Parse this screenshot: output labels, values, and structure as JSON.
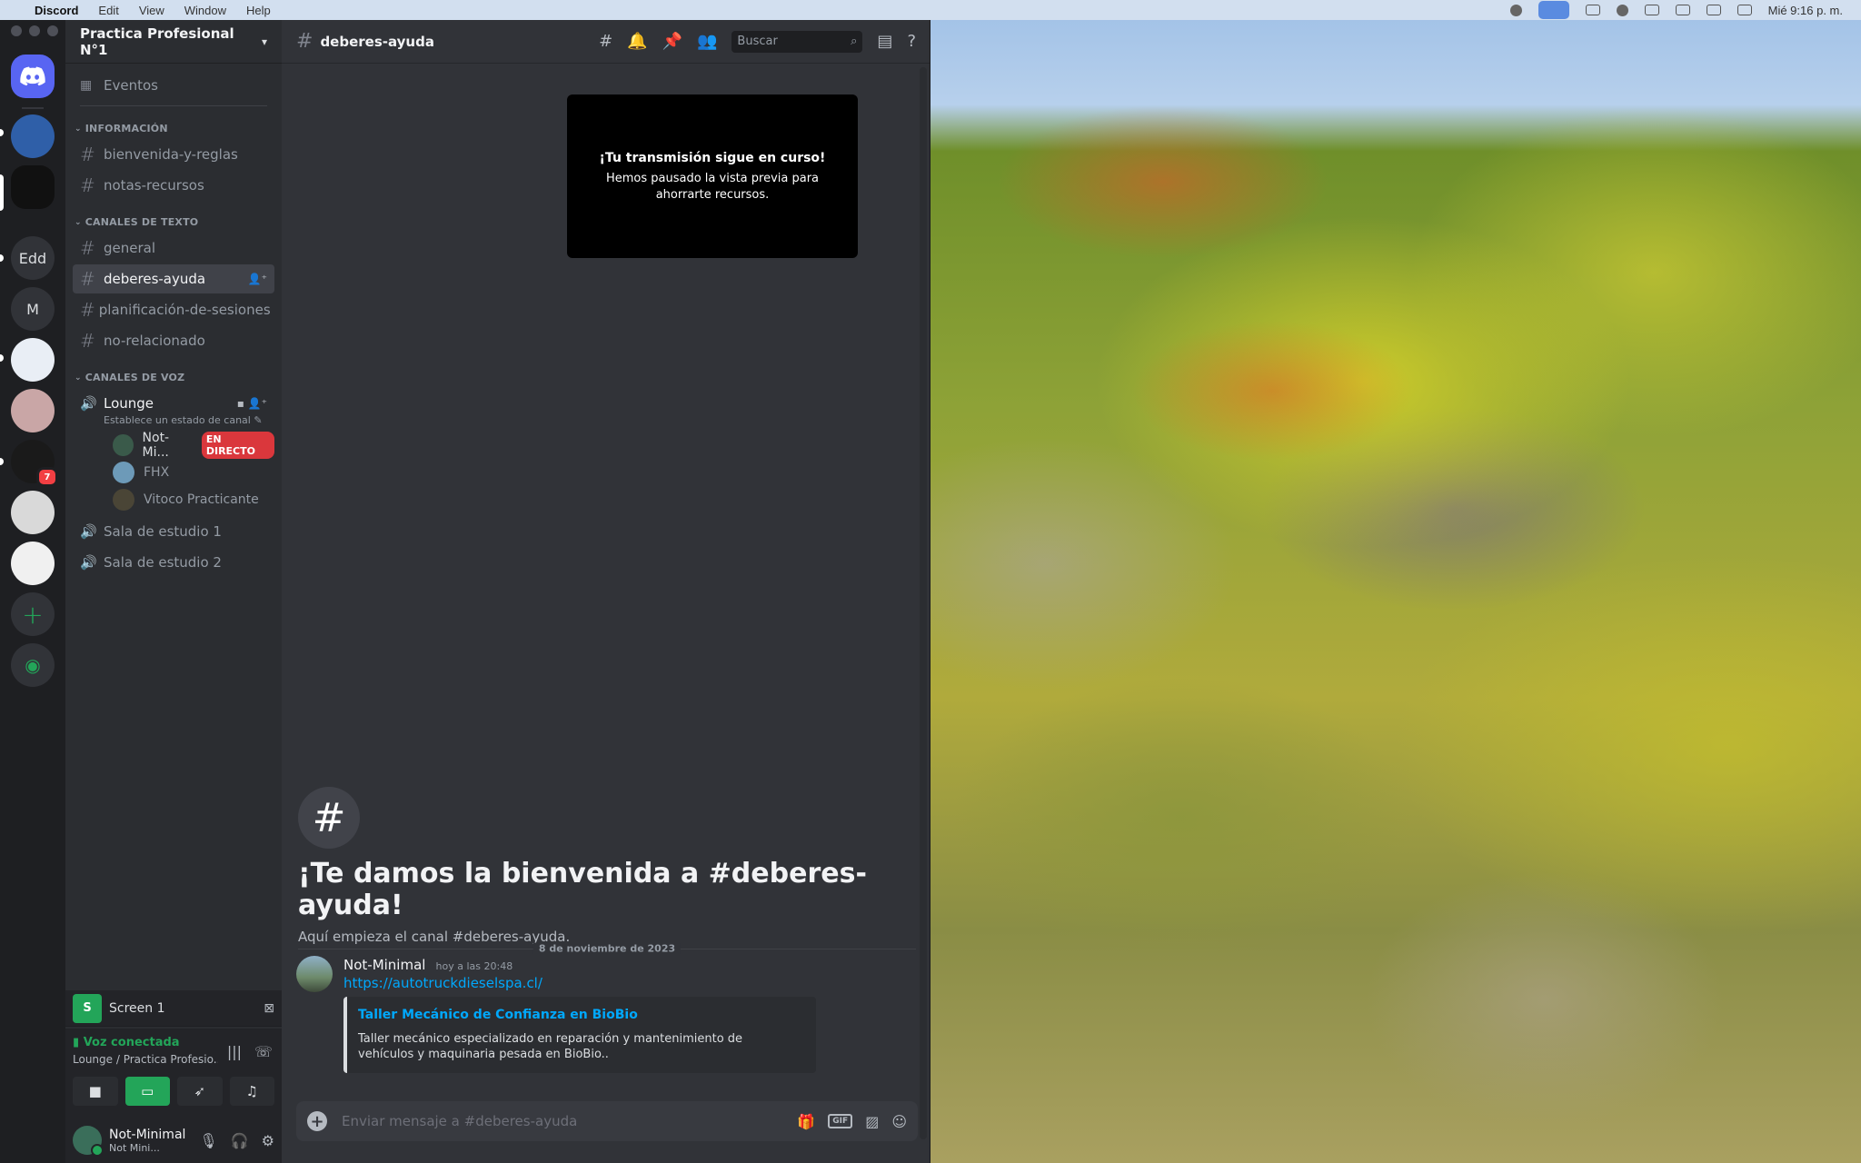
{
  "menubar": {
    "app": "Discord",
    "items": [
      "Edit",
      "View",
      "Window",
      "Help"
    ],
    "clock": "Mié 9:16 p. m."
  },
  "servers": {
    "edd_label": "Edd",
    "m_label": "M",
    "badge_count": "7"
  },
  "guild": {
    "name": "Practica Profesional N°1",
    "events_label": "Eventos"
  },
  "categories": {
    "info": "INFORMACIÓN",
    "text": "CANALES DE TEXTO",
    "voice": "CANALES DE VOZ"
  },
  "channels": {
    "info": [
      "bienvenida-y-reglas",
      "notas-recursos"
    ],
    "text": [
      "general",
      "deberes-ayuda",
      "planificación-de-sesiones",
      "no-relacionado"
    ]
  },
  "voice": {
    "lounge": "Lounge",
    "lounge_status": "Establece un estado de canal",
    "users": [
      "Not-Mi...",
      "FHX",
      "Vitoco Practicante"
    ],
    "live_badge": "EN DIRECTO",
    "rooms": [
      "Sala de estudio 1",
      "Sala de estudio 2"
    ]
  },
  "screen_panel": {
    "thumb": "S",
    "label": "Screen 1"
  },
  "voice_panel": {
    "status": "Voz conectada",
    "location": "Lounge / Practica Profesio..."
  },
  "user_panel": {
    "name": "Not-Minimal",
    "status": "Not Mini..."
  },
  "topbar": {
    "channel": "deberes-ayuda",
    "search_placeholder": "Buscar"
  },
  "stream_card": {
    "title": "¡Tu transmisión sigue en curso!",
    "body": "Hemos pausado la vista previa para ahorrarte recursos."
  },
  "welcome": {
    "title": "¡Te damos la bienvenida a #deberes-ayuda!",
    "subtitle": "Aquí empieza el canal #deberes-ayuda."
  },
  "date_divider": "8 de noviembre de 2023",
  "message": {
    "author": "Not-Minimal",
    "time": "hoy a las 20:48",
    "link": "https://autotruckdieselspa.cl/",
    "embed_title": "Taller Mecánico de Confianza en BioBio",
    "embed_desc": "Taller mecánico especializado en reparación y mantenimiento de vehículos y maquinaria pesada en BioBio.."
  },
  "composer": {
    "placeholder": "Enviar mensaje a #deberes-ayuda",
    "gif_label": "GIF"
  }
}
